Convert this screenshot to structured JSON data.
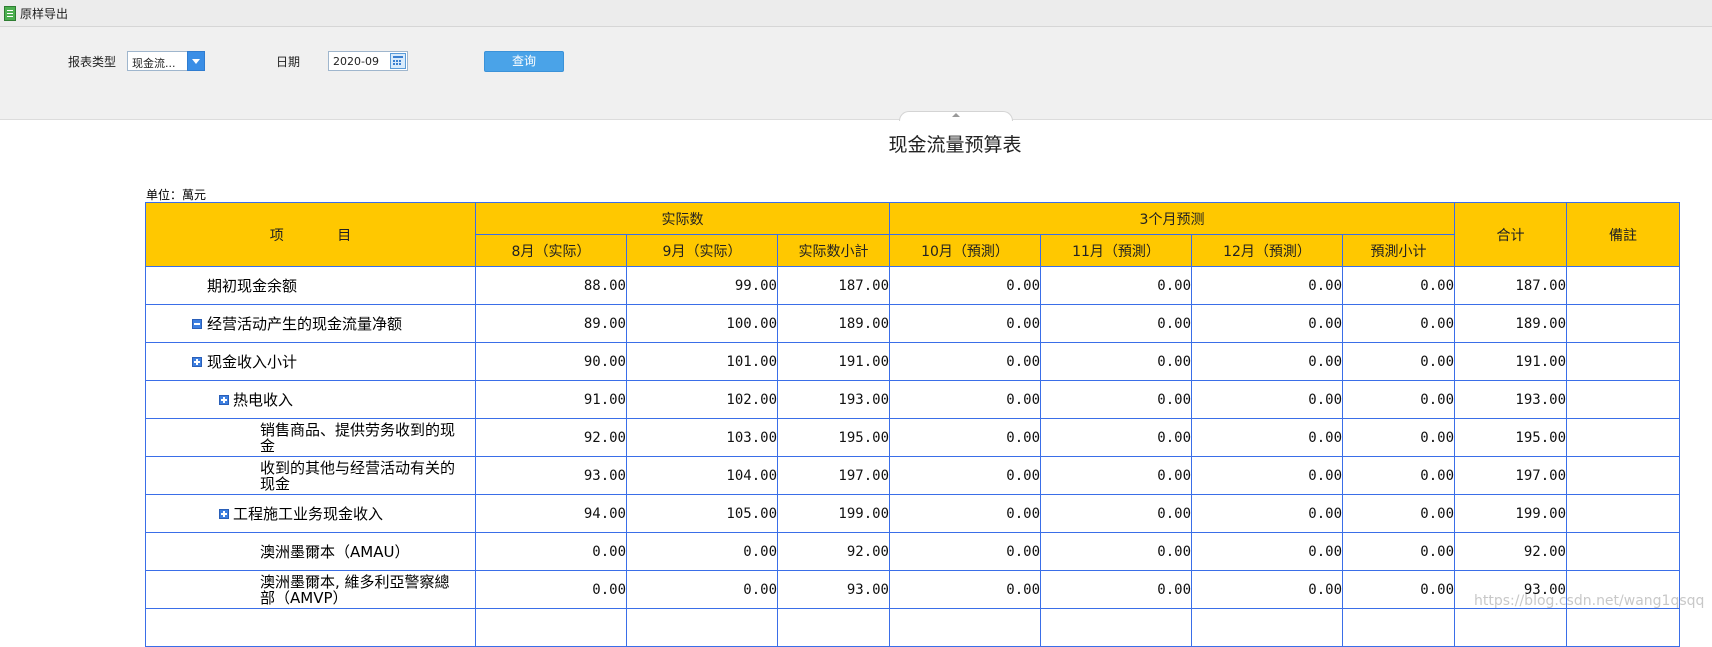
{
  "toolbar": {
    "export_label": "原样导出"
  },
  "filters": {
    "report_type_label": "报表类型",
    "report_type_value": "现金流...",
    "date_label": "日期",
    "date_value": "2020-09",
    "query_label": "查询"
  },
  "report": {
    "title": "现金流量预算表",
    "unit": "单位：萬元",
    "headers": {
      "item": "项            目",
      "actual_group": "实际数",
      "forecast_group": "3个月预测",
      "total": "合计",
      "remark": "備註",
      "cols": [
        "8月（实际）",
        "9月（实际）",
        "实际数小計",
        "10月（預測）",
        "11月（預測）",
        "12月（預測）",
        "預測小计"
      ]
    },
    "rows": [
      {
        "name": "期初现金余额",
        "indent": 0,
        "toggle": "none",
        "values": [
          "88.00",
          "99.00",
          "187.00",
          "0.00",
          "0.00",
          "0.00",
          "0.00",
          "187.00"
        ],
        "remark": ""
      },
      {
        "name": "经营活动产生的现金流量净额",
        "indent": 0,
        "toggle": "minus",
        "values": [
          "89.00",
          "100.00",
          "189.00",
          "0.00",
          "0.00",
          "0.00",
          "0.00",
          "189.00"
        ],
        "remark": ""
      },
      {
        "name": "现金收入小计",
        "indent": 1,
        "toggle": "plus",
        "values": [
          "90.00",
          "101.00",
          "191.00",
          "0.00",
          "0.00",
          "0.00",
          "0.00",
          "191.00"
        ],
        "remark": ""
      },
      {
        "name": "热电收入",
        "indent": 2,
        "toggle": "plus",
        "values": [
          "91.00",
          "102.00",
          "193.00",
          "0.00",
          "0.00",
          "0.00",
          "0.00",
          "193.00"
        ],
        "remark": ""
      },
      {
        "name_lines": [
          "销售商品、提供劳务收到的现",
          "金"
        ],
        "indent": 3,
        "toggle": "none",
        "values": [
          "92.00",
          "103.00",
          "195.00",
          "0.00",
          "0.00",
          "0.00",
          "0.00",
          "195.00"
        ],
        "remark": ""
      },
      {
        "name_lines": [
          "收到的其他与经营活动有关的",
          "现金"
        ],
        "indent": 3,
        "toggle": "none",
        "values": [
          "93.00",
          "104.00",
          "197.00",
          "0.00",
          "0.00",
          "0.00",
          "0.00",
          "197.00"
        ],
        "remark": ""
      },
      {
        "name": "工程施工业务现金收入",
        "indent": 2,
        "toggle": "plus",
        "values": [
          "94.00",
          "105.00",
          "199.00",
          "0.00",
          "0.00",
          "0.00",
          "0.00",
          "199.00"
        ],
        "remark": ""
      },
      {
        "name": "澳洲墨爾本（AMAU）",
        "indent": 3,
        "toggle": "none",
        "values": [
          "0.00",
          "0.00",
          "92.00",
          "0.00",
          "0.00",
          "0.00",
          "0.00",
          "92.00"
        ],
        "remark": ""
      },
      {
        "name_lines": [
          "澳洲墨爾本, 維多利亞警察總",
          "部（AMVP）"
        ],
        "indent": 3,
        "toggle": "none",
        "values": [
          "0.00",
          "0.00",
          "93.00",
          "0.00",
          "0.00",
          "0.00",
          "0.00",
          "93.00"
        ],
        "remark": ""
      },
      {
        "name": "",
        "indent": 3,
        "toggle": "none",
        "values": [
          "",
          "",
          "",
          "",
          "",
          "",
          "",
          ""
        ],
        "remark": ""
      }
    ]
  },
  "watermark": "https://blog.csdn.net/wang1qsqq",
  "colors": {
    "header_bg": "#ffc800",
    "grid_line": "#3a6ee8",
    "query_btn": "#4aa3e8"
  },
  "icons": {
    "export": "excel-export-icon",
    "dropdown": "chevron-down-icon",
    "calendar": "calendar-icon",
    "expand": "plus-square-icon",
    "collapse": "minus-square-icon"
  }
}
